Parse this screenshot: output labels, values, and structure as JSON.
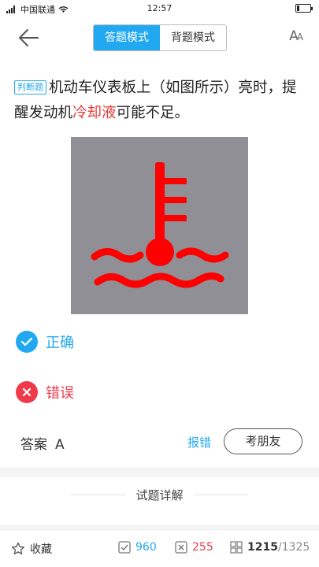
{
  "status_bar": {
    "carrier": "中国联通",
    "time": "12:57"
  },
  "header": {
    "modes": [
      {
        "label": "答题模式",
        "active": true
      },
      {
        "label": "背题模式",
        "active": false
      }
    ],
    "font_button": "AA"
  },
  "question": {
    "type_tag": "判断题",
    "text_before": "机动车仪表板上（如图所示）亮时，提醒发动机",
    "text_highlight": "冷却液",
    "text_after": "可能不足。",
    "figure_icon": "coolant-temperature-warning-icon"
  },
  "options": [
    {
      "label": "正确",
      "icon": "check-icon",
      "color": "#22a8f0"
    },
    {
      "label": "错误",
      "icon": "cross-icon",
      "color": "#ee3a4a"
    }
  ],
  "answer": {
    "label": "答案",
    "value": "A"
  },
  "actions": {
    "report": "报错",
    "ask_friend": "考朋友"
  },
  "detail": {
    "title": "试题详解"
  },
  "bottom_bar": {
    "favorite": "收藏",
    "correct_count": "960",
    "wrong_count": "255",
    "progress_current": "1215",
    "progress_total": "/1325"
  },
  "colors": {
    "accent": "#22a8f0",
    "wrong": "#ee3a4a",
    "icon_red": "#ff0000",
    "figure_bg": "#8f8f95"
  }
}
